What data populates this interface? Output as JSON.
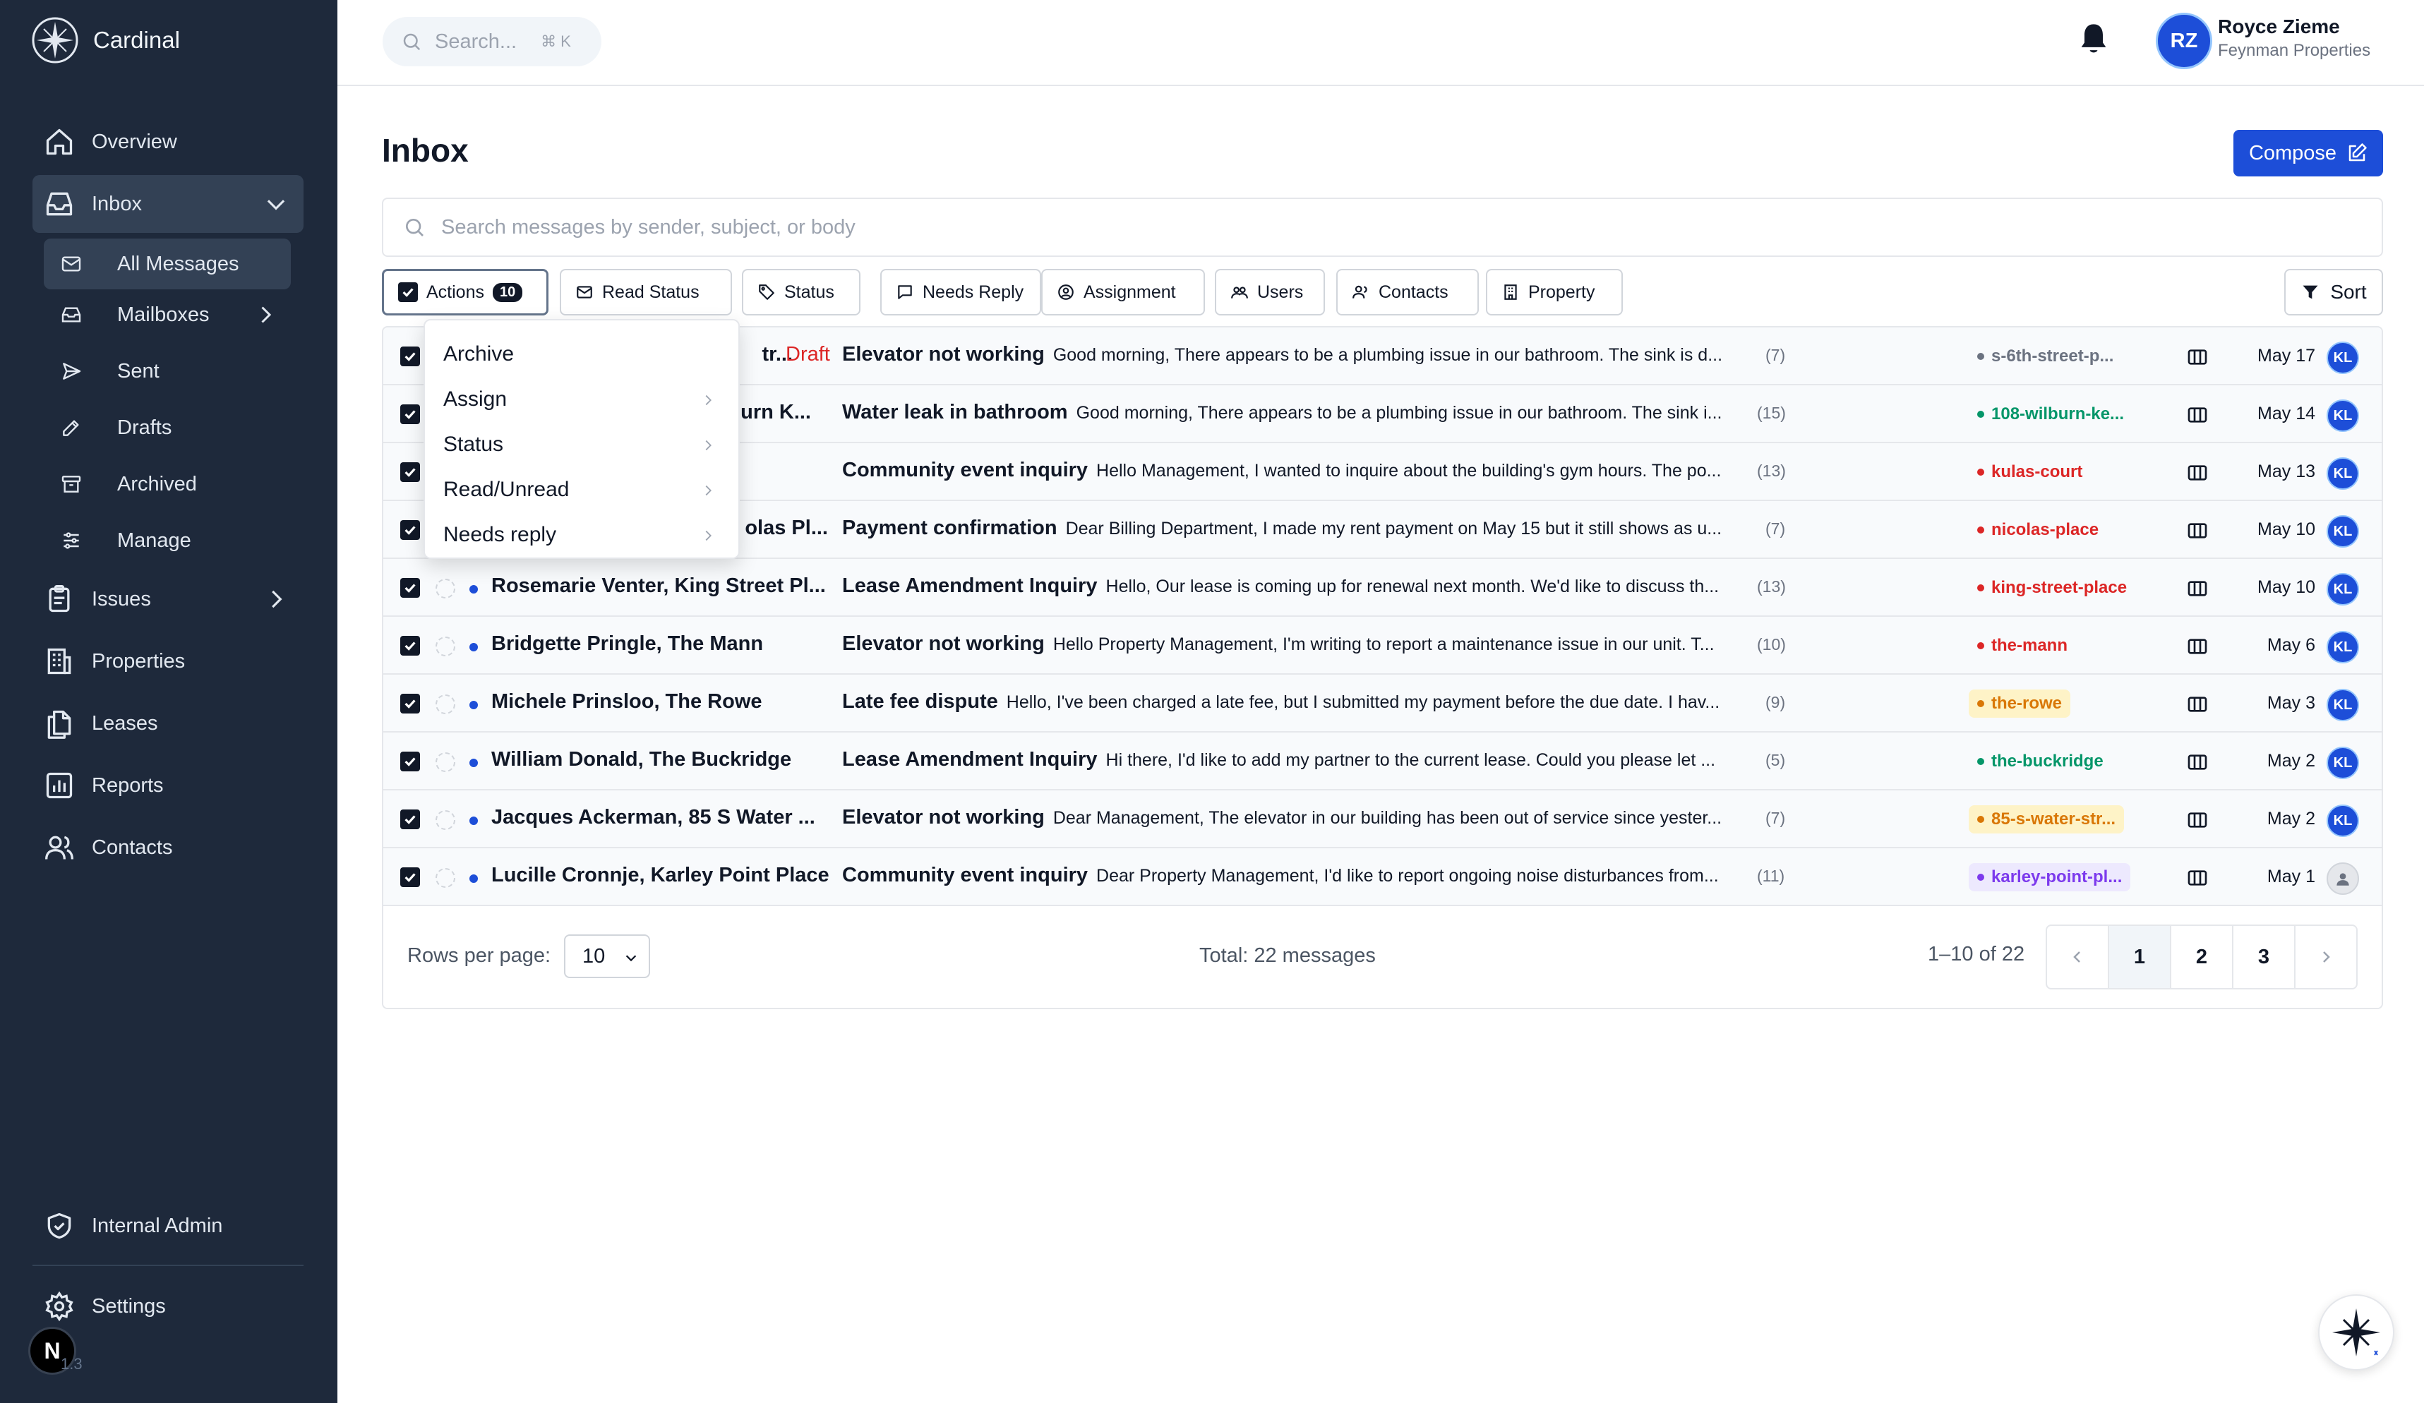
{
  "app": {
    "name": "Cardinal"
  },
  "sidebar": {
    "nav": [
      {
        "label": "Overview"
      },
      {
        "label": "Inbox"
      },
      {
        "label": "Issues"
      },
      {
        "label": "Properties"
      },
      {
        "label": "Leases"
      },
      {
        "label": "Reports"
      },
      {
        "label": "Contacts"
      }
    ],
    "inbox_sub": [
      {
        "label": "All Messages"
      },
      {
        "label": "Mailboxes"
      },
      {
        "label": "Sent"
      },
      {
        "label": "Drafts"
      },
      {
        "label": "Archived"
      },
      {
        "label": "Manage"
      }
    ],
    "bottom": [
      {
        "label": "Internal Admin"
      },
      {
        "label": "Settings"
      }
    ],
    "version_badge": "N",
    "version_text": "1.3"
  },
  "header": {
    "search_placeholder": "Search...",
    "search_shortcut": "⌘ K",
    "user_initials": "RZ",
    "user_name": "Royce Zieme",
    "user_org": "Feynman Properties"
  },
  "main": {
    "title": "Inbox",
    "compose_label": "Compose",
    "search_placeholder": "Search messages by sender, subject, or body",
    "filters": {
      "actions_label": "Actions",
      "actions_count": "10",
      "read_status": "Read Status",
      "status": "Status",
      "needs_reply": "Needs Reply",
      "assignment": "Assignment",
      "users": "Users",
      "contacts": "Contacts",
      "property": "Property"
    },
    "sort_label": "Sort",
    "actions_menu": [
      {
        "label": "Archive",
        "has_submenu": false
      },
      {
        "label": "Assign",
        "has_submenu": true
      },
      {
        "label": "Status",
        "has_submenu": true
      },
      {
        "label": "Read/Unread",
        "has_submenu": true
      },
      {
        "label": "Needs reply",
        "has_submenu": true
      }
    ],
    "messages": [
      {
        "sender": "tr...",
        "draft": "Draft",
        "subject": "Elevator not working",
        "preview": "Good morning, There appears to be a plumbing issue in our bathroom. The sink is d...",
        "count": "(7)",
        "tag": "s-6th-street-p...",
        "tag_color": "#6b7280",
        "tag_bg": "transparent",
        "date": "May 17",
        "assignee": "KL"
      },
      {
        "sender": "lburn K...",
        "draft": "",
        "subject": "Water leak in bathroom",
        "preview": "Good morning, There appears to be a plumbing issue in our bathroom. The sink i...",
        "count": "(15)",
        "tag": "108-wilburn-ke...",
        "tag_color": "#059669",
        "tag_bg": "transparent",
        "date": "May 14",
        "assignee": "KL"
      },
      {
        "sender": "",
        "draft": "",
        "subject": "Community event inquiry",
        "preview": "Hello Management, I wanted to inquire about the building's gym hours. The po...",
        "count": "(13)",
        "tag": "kulas-court",
        "tag_color": "#dc2626",
        "tag_bg": "transparent",
        "date": "May 13",
        "assignee": "KL"
      },
      {
        "sender": "olas Pl...",
        "draft": "",
        "subject": "Payment confirmation",
        "preview": "Dear Billing Department, I made my rent payment on May 15 but it still shows as u...",
        "count": "(7)",
        "tag": "nicolas-place",
        "tag_color": "#dc2626",
        "tag_bg": "transparent",
        "date": "May 10",
        "assignee": "KL"
      },
      {
        "sender": "Rosemarie Venter, King Street Pl...",
        "draft": "",
        "subject": "Lease Amendment Inquiry",
        "preview": "Hello, Our lease is coming up for renewal next month. We'd like to discuss th...",
        "count": "(13)",
        "tag": "king-street-place",
        "tag_color": "#dc2626",
        "tag_bg": "transparent",
        "date": "May 10",
        "assignee": "KL"
      },
      {
        "sender": "Bridgette Pringle, The Mann",
        "draft": "",
        "subject": "Elevator not working",
        "preview": "Hello Property Management, I'm writing to report a maintenance issue in our unit. T...",
        "count": "(10)",
        "tag": "the-mann",
        "tag_color": "#dc2626",
        "tag_bg": "transparent",
        "date": "May 6",
        "assignee": "KL"
      },
      {
        "sender": "Michele Prinsloo, The Rowe",
        "draft": "",
        "subject": "Late fee dispute",
        "preview": "Hello, I've been charged a late fee, but I submitted my payment before the due date. I hav...",
        "count": "(9)",
        "tag": "the-rowe",
        "tag_color": "#d97706",
        "tag_bg": "#fef3c7",
        "date": "May 3",
        "assignee": "KL"
      },
      {
        "sender": "William Donald, The Buckridge",
        "draft": "",
        "subject": "Lease Amendment Inquiry",
        "preview": "Hi there, I'd like to add my partner to the current lease. Could you please let ...",
        "count": "(5)",
        "tag": "the-buckridge",
        "tag_color": "#059669",
        "tag_bg": "transparent",
        "date": "May 2",
        "assignee": "KL"
      },
      {
        "sender": "Jacques Ackerman, 85 S Water ...",
        "draft": "",
        "subject": "Elevator not working",
        "preview": "Dear Management, The elevator in our building has been out of service since yester...",
        "count": "(7)",
        "tag": "85-s-water-str...",
        "tag_color": "#d97706",
        "tag_bg": "#fef3c7",
        "date": "May 2",
        "assignee": "KL"
      },
      {
        "sender": "Lucille Cronnje, Karley Point Place",
        "draft": "",
        "subject": "Community event inquiry",
        "preview": "Dear Property Management, I'd like to report ongoing noise disturbances from...",
        "count": "(11)",
        "tag": "karley-point-pl...",
        "tag_color": "#7c3aed",
        "tag_bg": "#ede9fe",
        "date": "May 1",
        "assignee": ""
      }
    ],
    "pagination": {
      "rows_per_page_label": "Rows per page:",
      "rows_per_page": "10",
      "total": "Total: 22 messages",
      "range": "1–10 of 22",
      "pages": [
        "1",
        "2",
        "3"
      ],
      "current": "1"
    }
  },
  "colors": {
    "sidebar_bg": "#1e293b",
    "accent": "#1d4ed8"
  }
}
